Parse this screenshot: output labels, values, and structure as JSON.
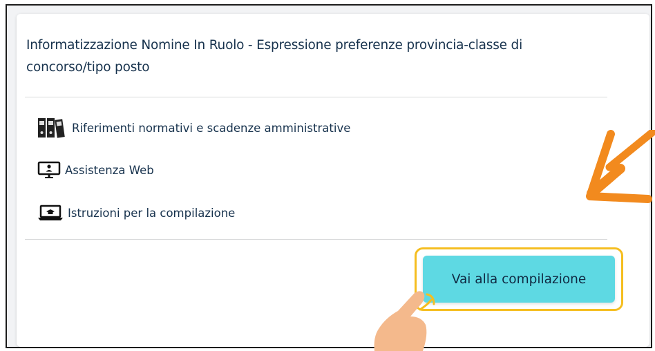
{
  "card": {
    "title": "Informatizzazione Nomine In Ruolo - Espressione preferenze provincia-classe di concorso/tipo posto",
    "links": [
      {
        "label": "Riferimenti normativi e scadenze amministrative",
        "icon": "binders-icon"
      },
      {
        "label": "Assistenza Web",
        "icon": "monitor-user-icon"
      },
      {
        "label": "Istruzioni per la compilazione",
        "icon": "laptop-graduation-icon"
      }
    ],
    "cta_label": "Vai alla compilazione"
  },
  "colors": {
    "title_text": "#17324d",
    "cta_background": "#5ed9e3",
    "highlight_border": "#f5be20",
    "arrow": "#f28a1e",
    "hand": "#f4b98c"
  },
  "annotations": {
    "arrow_icon": "orange-arrow-icon",
    "hand_icon": "pointing-hand-icon"
  }
}
